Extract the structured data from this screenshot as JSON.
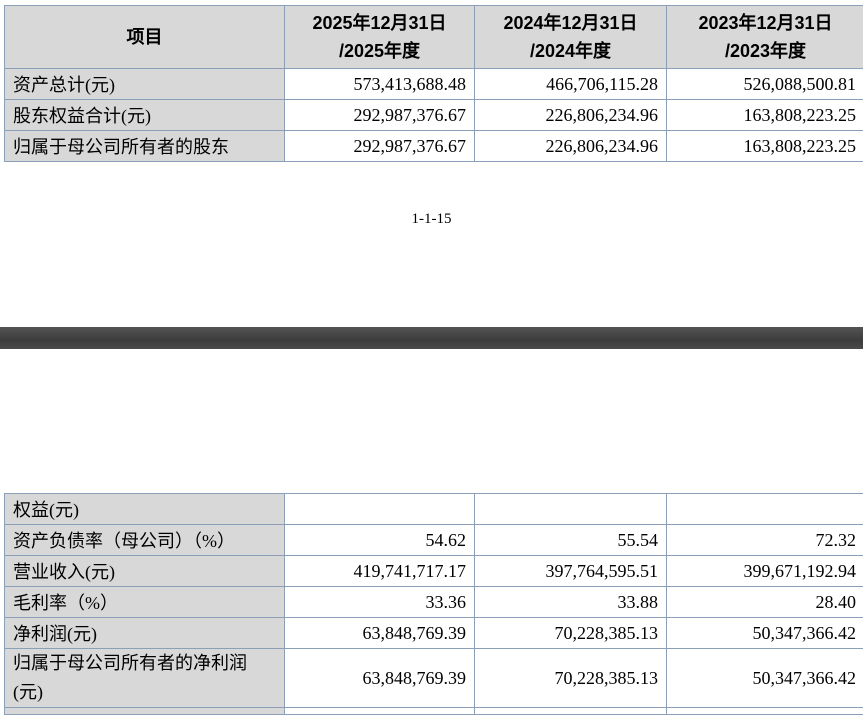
{
  "table_top": {
    "headers": [
      "项目",
      "2025年12月31日\n/2025年度",
      "2024年12月31日\n/2024年度",
      "2023年12月31日\n/2023年度"
    ],
    "header_lines": [
      [
        "项目"
      ],
      [
        "2025年12月31日",
        "/2025年度"
      ],
      [
        "2024年12月31日",
        "/2024年度"
      ],
      [
        "2023年12月31日",
        "/2023年度"
      ]
    ],
    "rows": [
      {
        "label": "资产总计(元)",
        "values": [
          "573,413,688.48",
          "466,706,115.28",
          "526,088,500.81"
        ]
      },
      {
        "label": "股东权益合计(元)",
        "values": [
          "292,987,376.67",
          "226,806,234.96",
          "163,808,223.25"
        ]
      },
      {
        "label": "归属于母公司所有者的股东",
        "values": [
          "292,987,376.67",
          "226,806,234.96",
          "163,808,223.25"
        ]
      }
    ]
  },
  "page_number": "1-1-15",
  "table_bottom": {
    "rows": [
      {
        "label": "权益(元)",
        "values": [
          "",
          "",
          ""
        ]
      },
      {
        "label": "资产负债率（母公司）（%）",
        "values": [
          "54.62",
          "55.54",
          "72.32"
        ]
      },
      {
        "label": "营业收入(元)",
        "values": [
          "419,741,717.17",
          "397,764,595.51",
          "399,671,192.94"
        ]
      },
      {
        "label": "毛利率（%）",
        "values": [
          "33.36",
          "33.88",
          "28.40"
        ]
      },
      {
        "label": "净利润(元)",
        "values": [
          "63,848,769.39",
          "70,228,385.13",
          "50,347,366.42"
        ]
      },
      {
        "label": "归属于母公司所有者的净利润(元)",
        "values": [
          "63,848,769.39",
          "70,228,385.13",
          "50,347,366.42"
        ]
      }
    ]
  }
}
